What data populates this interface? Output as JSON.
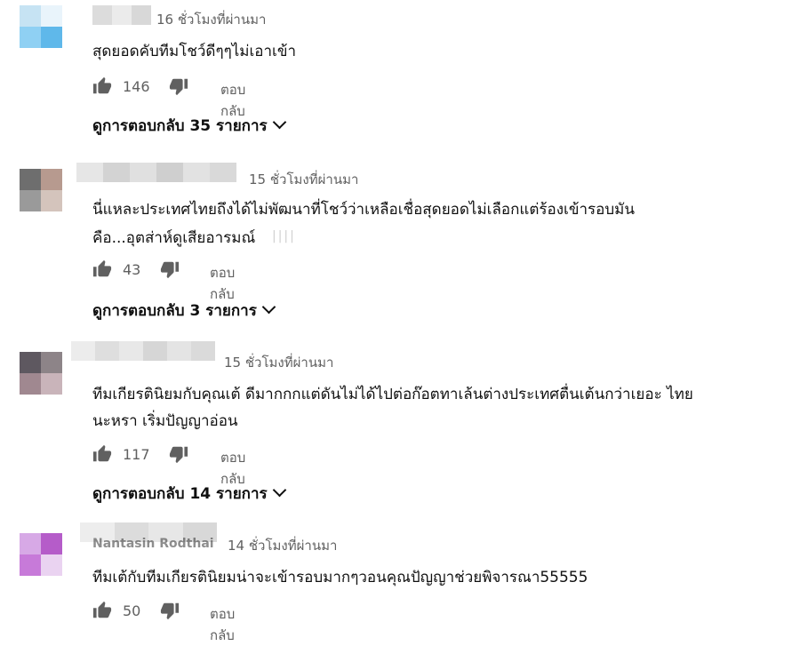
{
  "comments": [
    {
      "timestamp": "16 ชั่วโมงที่ผ่านมา",
      "lines": [
        "สุดยอดคับทีมโชว์ดีๆๆไม่เอาเข้า"
      ],
      "likes": "146",
      "reply_label": "ตอบกลับ",
      "view_replies": "ดูการตอบกลับ 35 รายการ",
      "avatar_colors": [
        "#c6e3f3",
        "#8fd0f3",
        "#5fb8ea",
        "#e9f4fb"
      ]
    },
    {
      "timestamp": "15 ชั่วโมงที่ผ่านมา",
      "lines": [
        "นี่แหละประเทศไทยถึงได้ไม่พัฒนาที่โชว์ว่าเหลือเชื่อสุดยอดไม่เลือกแต่ร้องเข้ารอบมัน",
        "คือ...อุตส่าห์ดูเสียอารมณ์"
      ],
      "likes": "43",
      "reply_label": "ตอบกลับ",
      "view_replies": "ดูการตอบกลับ 3 รายการ",
      "avatar_colors": [
        "#6e6e6e",
        "#b79a8f",
        "#9a9a9a",
        "#d4c4bc"
      ]
    },
    {
      "timestamp": "15 ชั่วโมงที่ผ่านมา",
      "lines": [
        "ทีมเกียรตินิยมกับคุณเต้   ดีมากกกแต่ดันไม่ได้ไปต่อก๊อตทาเล้นต่างประเทศตื่นเต้นกว่าเยอะ ไทย",
        "นะหรา เริ่มปัญญาอ่อน"
      ],
      "likes": "117",
      "reply_label": "ตอบกลับ",
      "view_replies": "ดูการตอบกลับ 14 รายการ",
      "avatar_colors": [
        "#5e5860",
        "#a08890",
        "#8d8488",
        "#c9b4ba"
      ]
    },
    {
      "name": "Nantasin Rodthai",
      "timestamp": "14 ชั่วโมงที่ผ่านมา",
      "lines": [
        "ทีมเต้กับทีมเกียรตินิยมน่าจะเข้ารอบมากๆวอนคุณปัญญาช่วยพิจารณา55555"
      ],
      "likes": "50",
      "reply_label": "ตอบกลับ",
      "avatar_colors": [
        "#d7a9e6",
        "#b55cc9",
        "#c77ad9",
        "#ead3f1"
      ]
    }
  ]
}
